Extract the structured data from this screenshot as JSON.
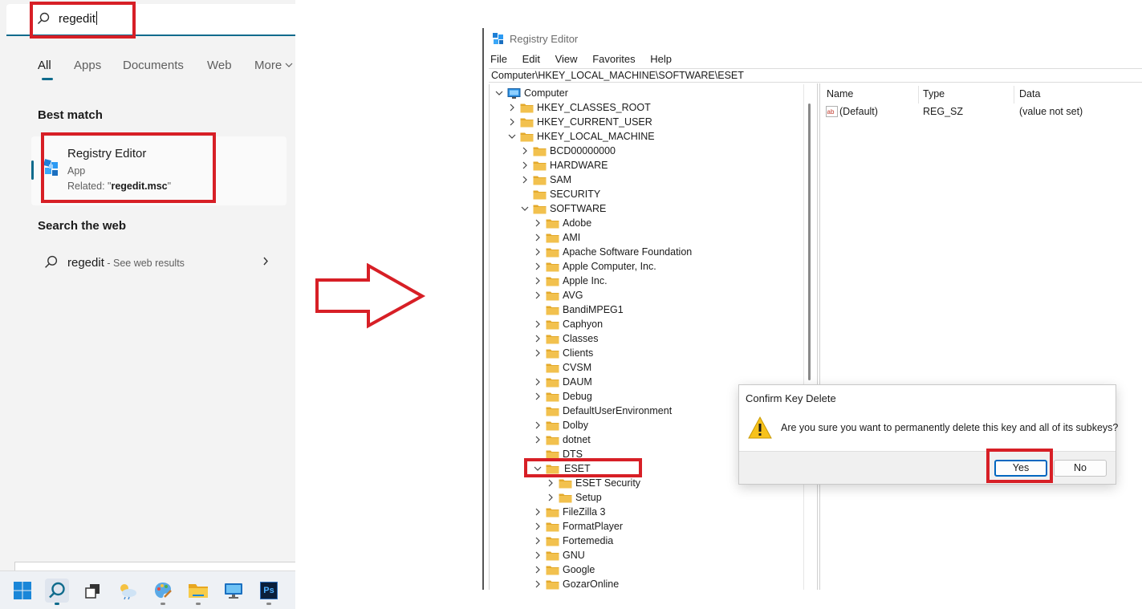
{
  "search": {
    "query": "regedit",
    "tabs": [
      "All",
      "Apps",
      "Documents",
      "Web",
      "More"
    ],
    "best_match_title": "Best match",
    "app_name": "Registry Editor",
    "app_kind": "App",
    "app_related_prefix": "Related: \"",
    "app_related_value": "regedit.msc",
    "app_related_suffix": "\"",
    "web_title": "Search the web",
    "web_query": "regedit",
    "web_suffix": " - See web results"
  },
  "taskbar": {
    "icons": [
      "windows-start-icon",
      "search-icon",
      "task-view-icon",
      "weather-icon",
      "paint-icon",
      "file-explorer-icon",
      "remote-desktop-icon",
      "photoshop-icon"
    ],
    "photoshop_label": "Ps"
  },
  "regedit": {
    "title": "Registry Editor",
    "menu": [
      "File",
      "Edit",
      "View",
      "Favorites",
      "Help"
    ],
    "address": "Computer\\HKEY_LOCAL_MACHINE\\SOFTWARE\\ESET",
    "tree": [
      {
        "label": "Computer",
        "level": 0,
        "state": "expanded",
        "icon": "computer"
      },
      {
        "label": "HKEY_CLASSES_ROOT",
        "level": 1,
        "state": "collapsed"
      },
      {
        "label": "HKEY_CURRENT_USER",
        "level": 1,
        "state": "collapsed"
      },
      {
        "label": "HKEY_LOCAL_MACHINE",
        "level": 1,
        "state": "expanded"
      },
      {
        "label": "BCD00000000",
        "level": 2,
        "state": "collapsed"
      },
      {
        "label": "HARDWARE",
        "level": 2,
        "state": "collapsed"
      },
      {
        "label": "SAM",
        "level": 2,
        "state": "collapsed"
      },
      {
        "label": "SECURITY",
        "level": 2,
        "state": "none"
      },
      {
        "label": "SOFTWARE",
        "level": 2,
        "state": "expanded"
      },
      {
        "label": "Adobe",
        "level": 3,
        "state": "collapsed"
      },
      {
        "label": "AMI",
        "level": 3,
        "state": "collapsed"
      },
      {
        "label": "Apache Software Foundation",
        "level": 3,
        "state": "collapsed"
      },
      {
        "label": "Apple Computer, Inc.",
        "level": 3,
        "state": "collapsed"
      },
      {
        "label": "Apple Inc.",
        "level": 3,
        "state": "collapsed"
      },
      {
        "label": "AVG",
        "level": 3,
        "state": "collapsed"
      },
      {
        "label": "BandiMPEG1",
        "level": 3,
        "state": "none"
      },
      {
        "label": "Caphyon",
        "level": 3,
        "state": "collapsed"
      },
      {
        "label": "Classes",
        "level": 3,
        "state": "collapsed"
      },
      {
        "label": "Clients",
        "level": 3,
        "state": "collapsed"
      },
      {
        "label": "CVSM",
        "level": 3,
        "state": "none"
      },
      {
        "label": "DAUM",
        "level": 3,
        "state": "collapsed"
      },
      {
        "label": "Debug",
        "level": 3,
        "state": "collapsed"
      },
      {
        "label": "DefaultUserEnvironment",
        "level": 3,
        "state": "none"
      },
      {
        "label": "Dolby",
        "level": 3,
        "state": "collapsed"
      },
      {
        "label": "dotnet",
        "level": 3,
        "state": "collapsed"
      },
      {
        "label": "DTS",
        "level": 3,
        "state": "none"
      },
      {
        "label": "ESET",
        "level": 3,
        "state": "expanded",
        "selected": true
      },
      {
        "label": "ESET Security",
        "level": 4,
        "state": "collapsed"
      },
      {
        "label": "Setup",
        "level": 4,
        "state": "collapsed"
      },
      {
        "label": "FileZilla 3",
        "level": 3,
        "state": "collapsed"
      },
      {
        "label": "FormatPlayer",
        "level": 3,
        "state": "collapsed"
      },
      {
        "label": "Fortemedia",
        "level": 3,
        "state": "collapsed"
      },
      {
        "label": "GNU",
        "level": 3,
        "state": "collapsed"
      },
      {
        "label": "Google",
        "level": 3,
        "state": "collapsed"
      },
      {
        "label": "GozarOnline",
        "level": 3,
        "state": "collapsed"
      }
    ],
    "columns": [
      "Name",
      "Type",
      "Data"
    ],
    "values": [
      {
        "name": "(Default)",
        "type": "REG_SZ",
        "data": "(value not set)",
        "icon": "ab"
      }
    ]
  },
  "dialog": {
    "title": "Confirm Key Delete",
    "message": "Are you sure you want to permanently delete this key and all of its subkeys?",
    "yes_label": "Yes",
    "no_label": "No"
  },
  "colors": {
    "highlight_box": "#d71f26",
    "accent": "#0f6b8c",
    "folder": "#f2c14e",
    "dialog_primary": "#0067c0"
  }
}
